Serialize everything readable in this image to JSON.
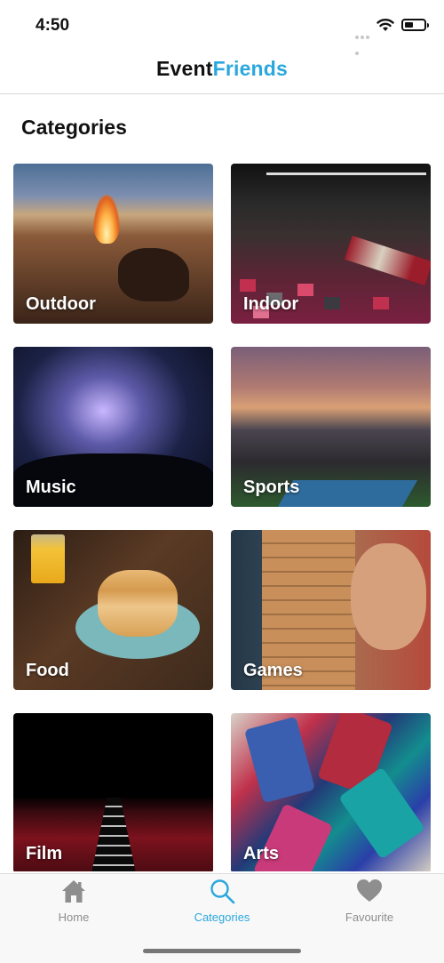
{
  "status_bar": {
    "time": "4:50",
    "battery_level": 0.45
  },
  "app": {
    "title_part1": "Event",
    "title_part2": "Friends",
    "accent_color": "#2aa7dd"
  },
  "page": {
    "title": "Categories"
  },
  "categories": [
    {
      "label": "Outdoor"
    },
    {
      "label": "Indoor"
    },
    {
      "label": "Music"
    },
    {
      "label": "Sports"
    },
    {
      "label": "Food"
    },
    {
      "label": "Games"
    },
    {
      "label": "Film"
    },
    {
      "label": "Arts"
    }
  ],
  "tab_bar": {
    "active": "Categories",
    "items": [
      {
        "label": "Home",
        "icon": "home-icon"
      },
      {
        "label": "Categories",
        "icon": "search-icon"
      },
      {
        "label": "Favourite",
        "icon": "heart-icon"
      }
    ]
  }
}
